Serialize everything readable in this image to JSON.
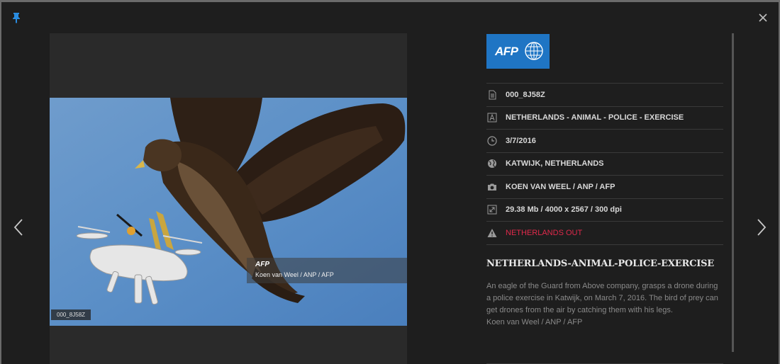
{
  "afp_logo": "AFP",
  "photo": {
    "id_badge": "000_8J58Z",
    "credit_logo": "AFP",
    "credit": "Koen van Weel / ANP / AFP"
  },
  "meta": [
    {
      "icon": "document-icon",
      "text": "000_8J58Z"
    },
    {
      "icon": "letter-a-icon",
      "text": "NETHERLANDS - ANIMAL - POLICE - EXERCISE"
    },
    {
      "icon": "clock-icon",
      "text": "3/7/2016"
    },
    {
      "icon": "globe-icon",
      "text": "KATWIJK, NETHERLANDS"
    },
    {
      "icon": "camera-icon",
      "text": "KOEN VAN WEEL / ANP / AFP"
    },
    {
      "icon": "resize-icon",
      "text": "29.38 Mb / 4000 x 2567 / 300 dpi"
    },
    {
      "icon": "warning-icon",
      "text": "NETHERLANDS OUT"
    }
  ],
  "headline": "NETHERLANDS-ANIMAL-POLICE-EXERCISE",
  "caption": "An eagle of the Guard from Above company, grasps a drone during a police exercise in Katwijk, on March 7, 2016. The bird of prey can get drones from the air by catching them with his legs.",
  "caption_credit": "Koen van Weel / ANP / AFP",
  "colors": {
    "afp_blue": "#1f75c4",
    "warning_red": "#e0294b",
    "pin_blue": "#2a8ce0"
  }
}
